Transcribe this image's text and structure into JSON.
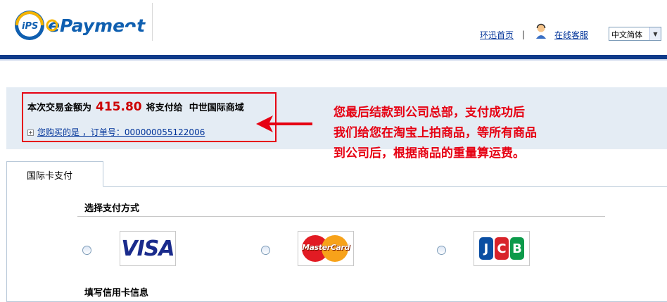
{
  "header": {
    "logo_text": "ePayment",
    "logo_badge": "iPS",
    "links": {
      "home": "环迅首页",
      "separator": "|",
      "support": "在线客服"
    },
    "language": "中文简体"
  },
  "payment_info": {
    "amount_label": "本次交易金额为",
    "amount": "415.80",
    "pay_to_label": "将支付给",
    "merchant": "中世国际商域",
    "order_text": "您购买的是 ，订单号：000000055122006"
  },
  "notice": {
    "line1": "您最后结款到公司总部，支付成功后",
    "line2": "我们给您在淘宝上拍商品，等所有商品",
    "line3": "到公司后，根据商品的重量算运费。"
  },
  "tabs": {
    "active": "国际卡支付"
  },
  "form": {
    "select_method_title": "选择支付方式",
    "card_info_title": "填写信用卡信息",
    "cards": [
      {
        "name": "VISA",
        "label": "VISA"
      },
      {
        "name": "MasterCard",
        "label": "MasterCard"
      },
      {
        "name": "JCB",
        "letters": [
          "J",
          "C",
          "B"
        ]
      }
    ]
  },
  "colors": {
    "brand_blue": "#0f3b8a",
    "highlight_red": "#e60012",
    "band_bg": "#e4ecf4",
    "link_blue": "#003399"
  }
}
